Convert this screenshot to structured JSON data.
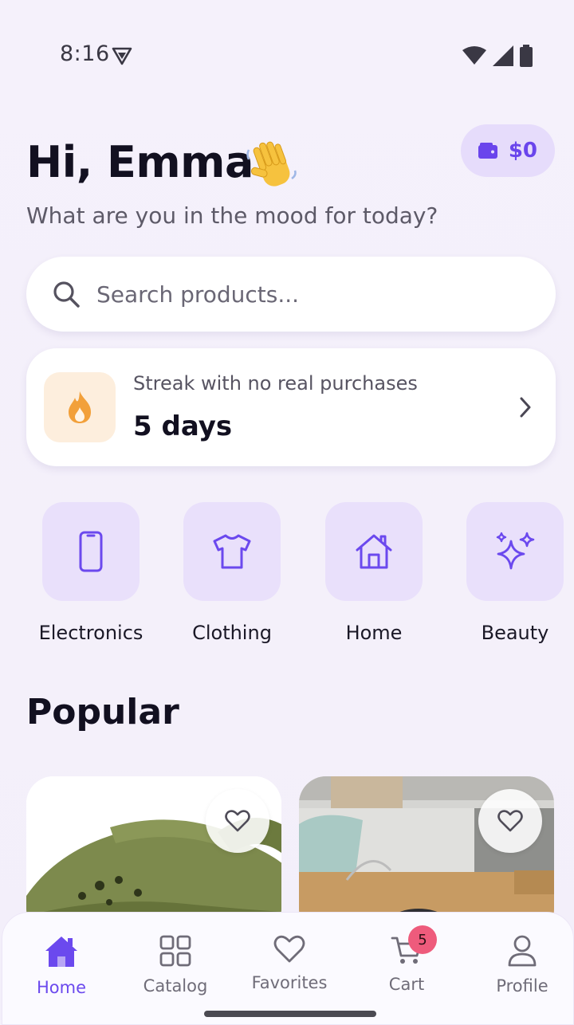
{
  "status_bar": {
    "time": "8:16"
  },
  "header": {
    "greeting": "Hi, Emma",
    "emoji": "waving-hand",
    "subtitle": "What are you in the mood for today?"
  },
  "wallet": {
    "amount": "$0",
    "icon": "wallet-icon"
  },
  "search": {
    "placeholder": "Search products..."
  },
  "streak": {
    "label": "Streak with no real purchases",
    "value": "5 days",
    "icon": "flame-icon"
  },
  "categories": [
    {
      "label": "Electronics",
      "icon": "phone-icon"
    },
    {
      "label": "Clothing",
      "icon": "tshirt-icon"
    },
    {
      "label": "Home",
      "icon": "house-icon"
    },
    {
      "label": "Beauty",
      "icon": "sparkles-icon"
    }
  ],
  "popular": {
    "title": "Popular"
  },
  "nav": {
    "items": [
      {
        "label": "Home",
        "icon": "home-icon",
        "active": true
      },
      {
        "label": "Catalog",
        "icon": "grid-icon"
      },
      {
        "label": "Favorites",
        "icon": "heart-icon"
      },
      {
        "label": "Cart",
        "icon": "cart-icon",
        "badge": "5"
      },
      {
        "label": "Profile",
        "icon": "person-icon"
      }
    ]
  },
  "colors": {
    "accent": "#6b49ee",
    "tile": "#e9e0fb",
    "badge": "#ee5b7c",
    "background": "#f4f0fa"
  }
}
